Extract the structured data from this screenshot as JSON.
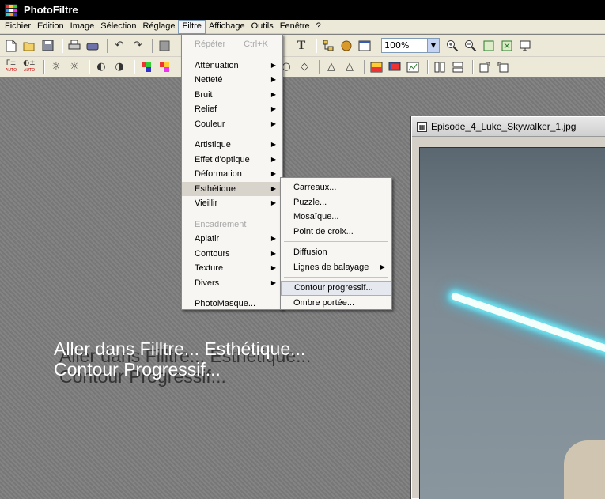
{
  "app": {
    "title": "PhotoFiltre"
  },
  "menubar": {
    "items": [
      "Fichier",
      "Edition",
      "Image",
      "Sélection",
      "Réglage",
      "Filtre",
      "Affichage",
      "Outils",
      "Fenêtre",
      "?"
    ]
  },
  "toolbar": {
    "zoom_value": "100%",
    "text_tool_label": "T",
    "auto_label": "AUTO"
  },
  "filtre_menu": {
    "items": [
      {
        "label": "Répéter",
        "shortcut": "Ctrl+K",
        "disabled": true
      },
      {
        "label": "Atténuation",
        "submenu": true
      },
      {
        "label": "Netteté",
        "submenu": true
      },
      {
        "label": "Bruit",
        "submenu": true
      },
      {
        "label": "Relief",
        "submenu": true
      },
      {
        "label": "Couleur",
        "submenu": true
      },
      {
        "label": "Artistique",
        "submenu": true
      },
      {
        "label": "Effet d'optique",
        "submenu": true
      },
      {
        "label": "Déformation",
        "submenu": true
      },
      {
        "label": "Esthétique",
        "submenu": true,
        "highlight": true
      },
      {
        "label": "Vieillir",
        "submenu": true
      },
      {
        "label": "Encadrement",
        "disabled": true
      },
      {
        "label": "Aplatir",
        "submenu": true
      },
      {
        "label": "Contours",
        "submenu": true
      },
      {
        "label": "Texture",
        "submenu": true
      },
      {
        "label": "Divers",
        "submenu": true
      },
      {
        "label": "PhotoMasque..."
      }
    ]
  },
  "esthetique_menu": {
    "items": [
      {
        "label": "Carreaux..."
      },
      {
        "label": "Puzzle..."
      },
      {
        "label": "Mosaïque..."
      },
      {
        "label": "Point de croix..."
      },
      {
        "label": "Diffusion"
      },
      {
        "label": "Lignes de balayage",
        "submenu": true
      },
      {
        "label": "Contour progressif...",
        "selected": true
      },
      {
        "label": "Ombre portée..."
      }
    ]
  },
  "image_window": {
    "title": "Episode_4_Luke_Skywalker_1.jpg"
  },
  "caption": {
    "line1": "Aller dans Filltre... Esthétique...",
    "line2": "Contour Progressif..."
  },
  "icons": {
    "new": "new-file-icon",
    "open": "open-folder-icon",
    "save": "save-disk-icon",
    "print": "print-icon",
    "undo": "undo-icon",
    "redo": "redo-icon",
    "zoom_in": "zoom-in-icon",
    "zoom_out": "zoom-out-icon"
  },
  "colors": {
    "title_bar": "#000000",
    "menu_bg": "#ece9d8",
    "lightsaber_glow": "#6fe3f0"
  }
}
